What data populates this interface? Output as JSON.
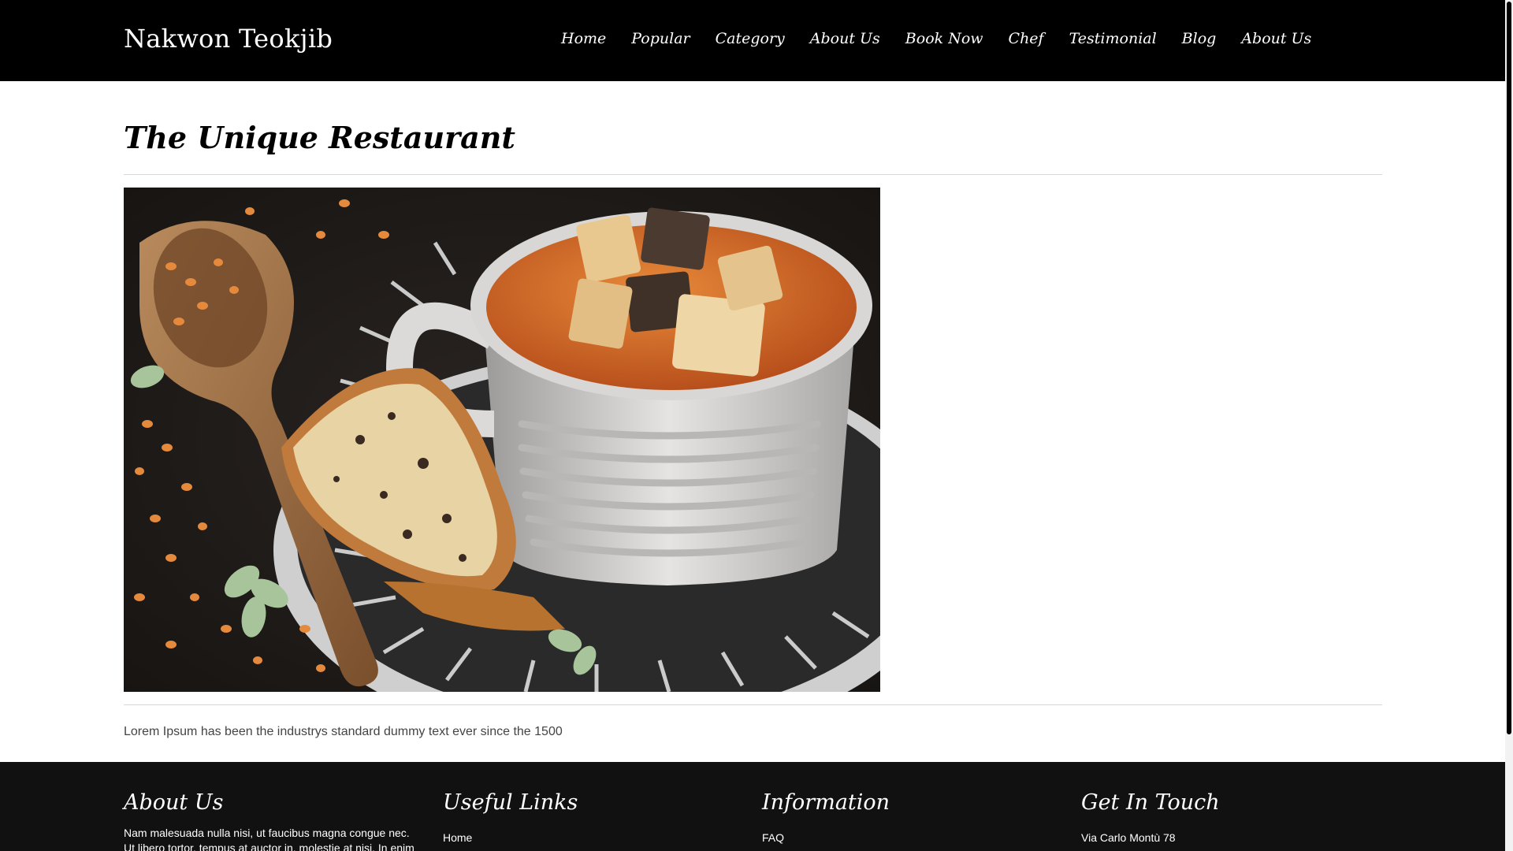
{
  "header": {
    "brand": "Nakwon Teokjib",
    "nav": [
      "Home",
      "Popular",
      "Category",
      "About Us",
      "Book Now",
      "Chef",
      "Testimonial",
      "Blog",
      "About Us"
    ]
  },
  "main": {
    "title": "The Unique Restaurant",
    "description": "Lorem Ipsum has been the industrys standard dummy text ever since the 1500"
  },
  "footer": {
    "about": {
      "title": "About Us",
      "text": "Nam malesuada nulla nisi, ut faucibus magna congue nec. Ut libero tortor, tempus at auctor in, molestie at nisi. In enim"
    },
    "links": {
      "title": "Useful Links",
      "first": "Home"
    },
    "info": {
      "title": "Information",
      "first": "FAQ"
    },
    "contact": {
      "title": "Get In Touch",
      "first": "Via Carlo Montù 78"
    }
  },
  "colors": {
    "header_bg": "#000000",
    "footer_bg": "#111111",
    "text": "#444444"
  }
}
